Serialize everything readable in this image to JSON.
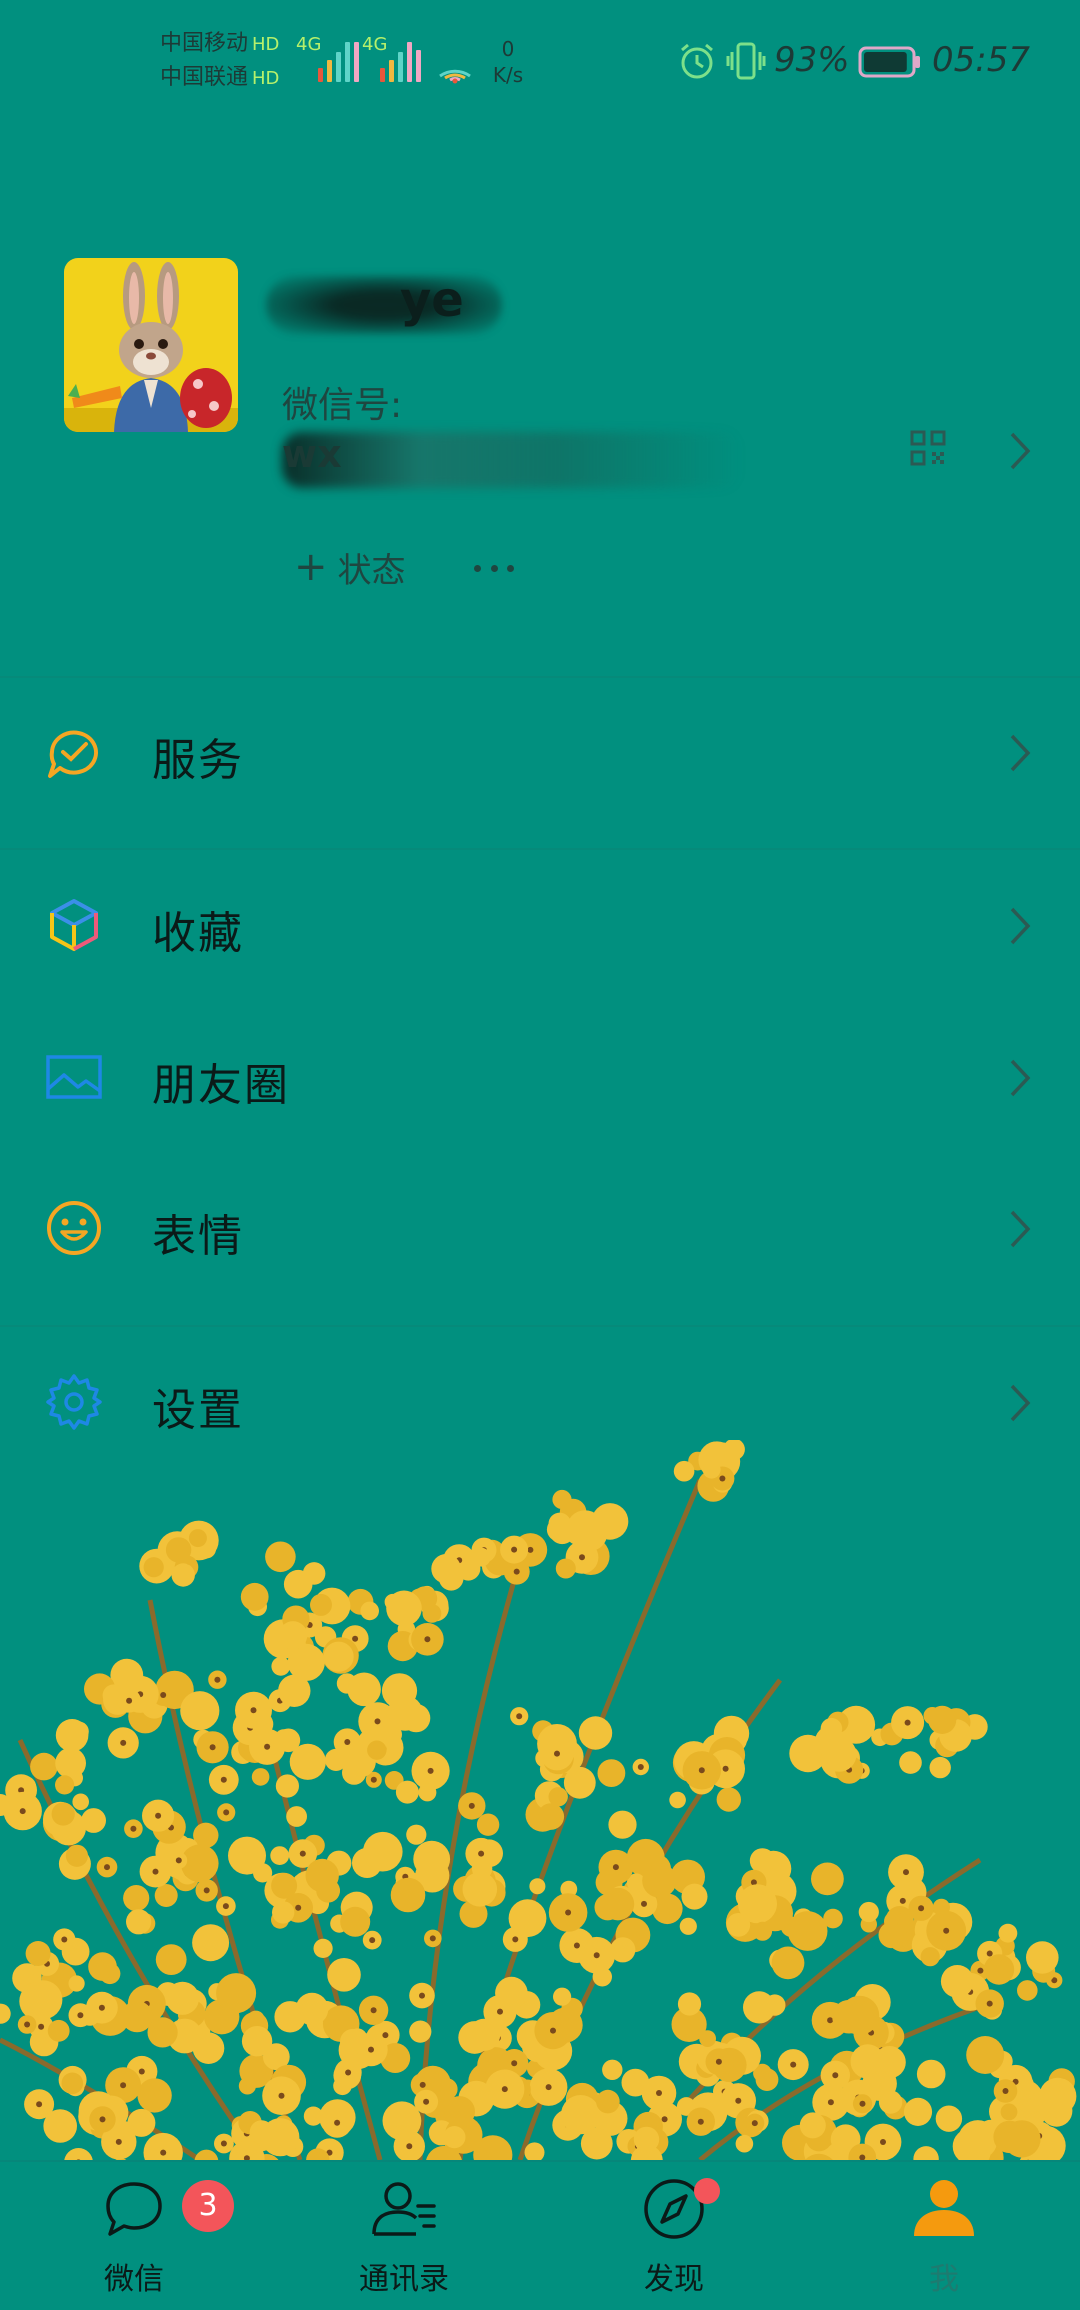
{
  "status_bar": {
    "carrier_1": "中国移动",
    "carrier_2": "中国联通",
    "hd": "HD",
    "network_1": "4G",
    "network_2": "4G",
    "speed_value": "0",
    "speed_unit": "K/s",
    "battery_percent": "93%",
    "time": "05:57",
    "battery_level": 0.93
  },
  "profile": {
    "nickname_visible_part": "ye",
    "wechat_id_label": "微信号:",
    "wechat_id_visible_part": "wx",
    "status_button": "状态",
    "status_plus": "+"
  },
  "menu": {
    "services": "服务",
    "favorites": "收藏",
    "moments": "朋友圈",
    "stickers": "表情",
    "settings": "设置"
  },
  "tabs": {
    "chats": "微信",
    "chats_badge": "3",
    "contacts": "通讯录",
    "discover": "发现",
    "me": "我"
  },
  "colors": {
    "background": "#01907f",
    "accent_orange": "#f5a623",
    "accent_blue": "#1e88e5",
    "badge_red": "#f3555a"
  }
}
